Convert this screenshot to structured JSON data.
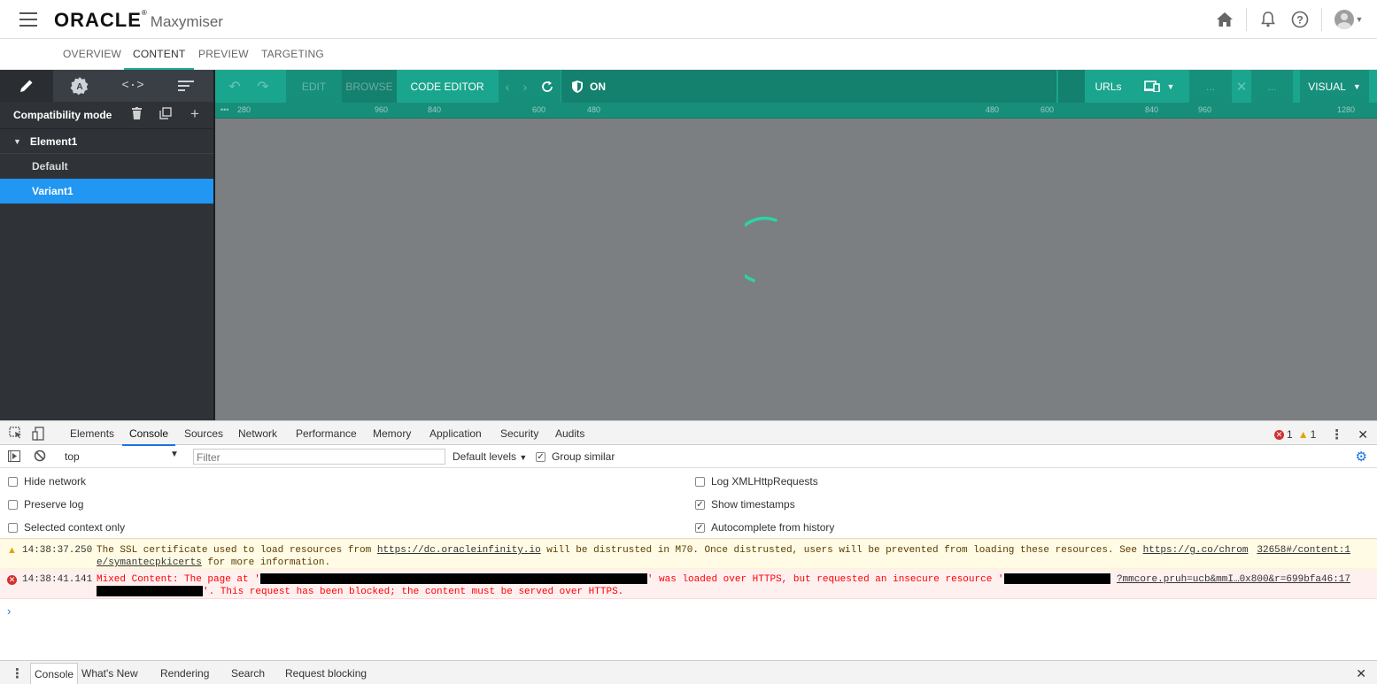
{
  "app": {
    "brand": "ORACLE",
    "reg_mark": "®",
    "product": "Maxymiser"
  },
  "nav_tabs": [
    "OVERVIEW",
    "CONTENT",
    "PREVIEW",
    "TARGETING"
  ],
  "left_panel": {
    "mode_label": "Compatibility mode",
    "element_label": "Element1",
    "variants": [
      "Default",
      "Variant1"
    ]
  },
  "toolbar": {
    "edit": "EDIT",
    "browse": "BROWSE",
    "code_editor": "CODE EDITOR",
    "toggle": "ON",
    "urls": "URLs",
    "visual": "VISUAL"
  },
  "ruler_ticks": [
    "•••",
    "280",
    "960",
    "840",
    "600",
    "480",
    "480",
    "600",
    "840",
    "960",
    "1280"
  ],
  "devtools": {
    "tabs": [
      "Elements",
      "Console",
      "Sources",
      "Network",
      "Performance",
      "Memory",
      "Application",
      "Security",
      "Audits"
    ],
    "error_count": "1",
    "warning_count": "1",
    "context": "top",
    "filter_placeholder": "Filter",
    "levels": "Default levels",
    "group_similar": "Group similar",
    "settings_left": [
      "Hide network",
      "Preserve log",
      "Selected context only"
    ],
    "settings_right": [
      "Log XMLHttpRequests",
      "Show timestamps",
      "Autocomplete from history"
    ],
    "warning_msg": {
      "time": "14:38:37.250",
      "part1": "The SSL certificate used to load resources from ",
      "link1": "https://dc.oracleinfinity.io",
      "part2": " will be distrusted in M70. Once distrusted, users will be prevented from loading these resources. See ",
      "link2": "https://g.co/chrom",
      "link2b": "e/symantecpkicerts",
      "part3": " for more information.",
      "source": "32658#/content:1"
    },
    "error_msg": {
      "time": "14:38:41.141",
      "part1": "Mixed Content: The page at '",
      "part2": "' was loaded over HTTPS, but requested an insecure resource '",
      "source": "?mmcore.pruh=ucb&mmI…0x800&r=699bfa46:17",
      "part3": "'. This request has been blocked; the content must be served over HTTPS."
    },
    "drawer_tabs": [
      "Console",
      "What's New",
      "Rendering",
      "Search",
      "Request blocking"
    ]
  }
}
